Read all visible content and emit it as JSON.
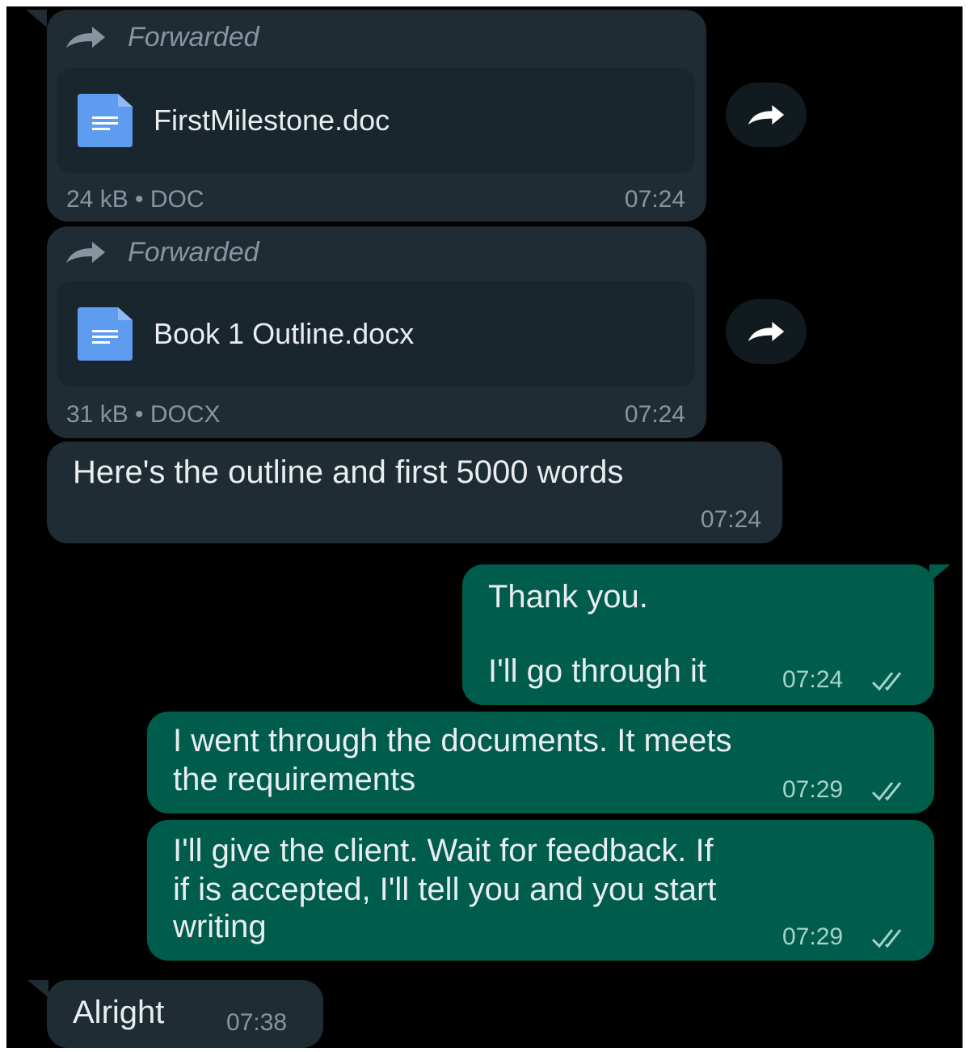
{
  "messages": {
    "doc1": {
      "forwarded_label": "Forwarded",
      "file_name": "FirstMilestone.doc",
      "meta": "24 kB • DOC",
      "time": "07:24"
    },
    "doc2": {
      "forwarded_label": "Forwarded",
      "file_name": "Book 1 Outline.docx",
      "meta": "31 kB • DOCX",
      "time": "07:24"
    },
    "text1": {
      "text": "Here's the outline and first 5000 words",
      "time": "07:24"
    },
    "out1": {
      "line1": "Thank you.",
      "line2": "I'll go through it",
      "time": "07:24"
    },
    "out2": {
      "line1": "I went through the documents. It meets",
      "line2": "the requirements",
      "time": "07:29"
    },
    "out3": {
      "line1": "I'll give the client.  Wait for feedback. If",
      "line2": "if is accepted, I'll tell you and you start",
      "line3": "writing",
      "time": "07:29"
    },
    "in_last": {
      "text": "Alright",
      "time": "07:38"
    }
  },
  "colors": {
    "background": "#000000",
    "incoming_bubble": "#1f2c33",
    "outgoing_bubble": "#005c4b",
    "doc_icon": "#5e9cef",
    "meta_text": "#8696a0"
  },
  "icons": {
    "forwarded": "forward-arrow-icon",
    "document": "document-icon",
    "share": "share-icon",
    "read_receipt": "double-check-icon"
  }
}
